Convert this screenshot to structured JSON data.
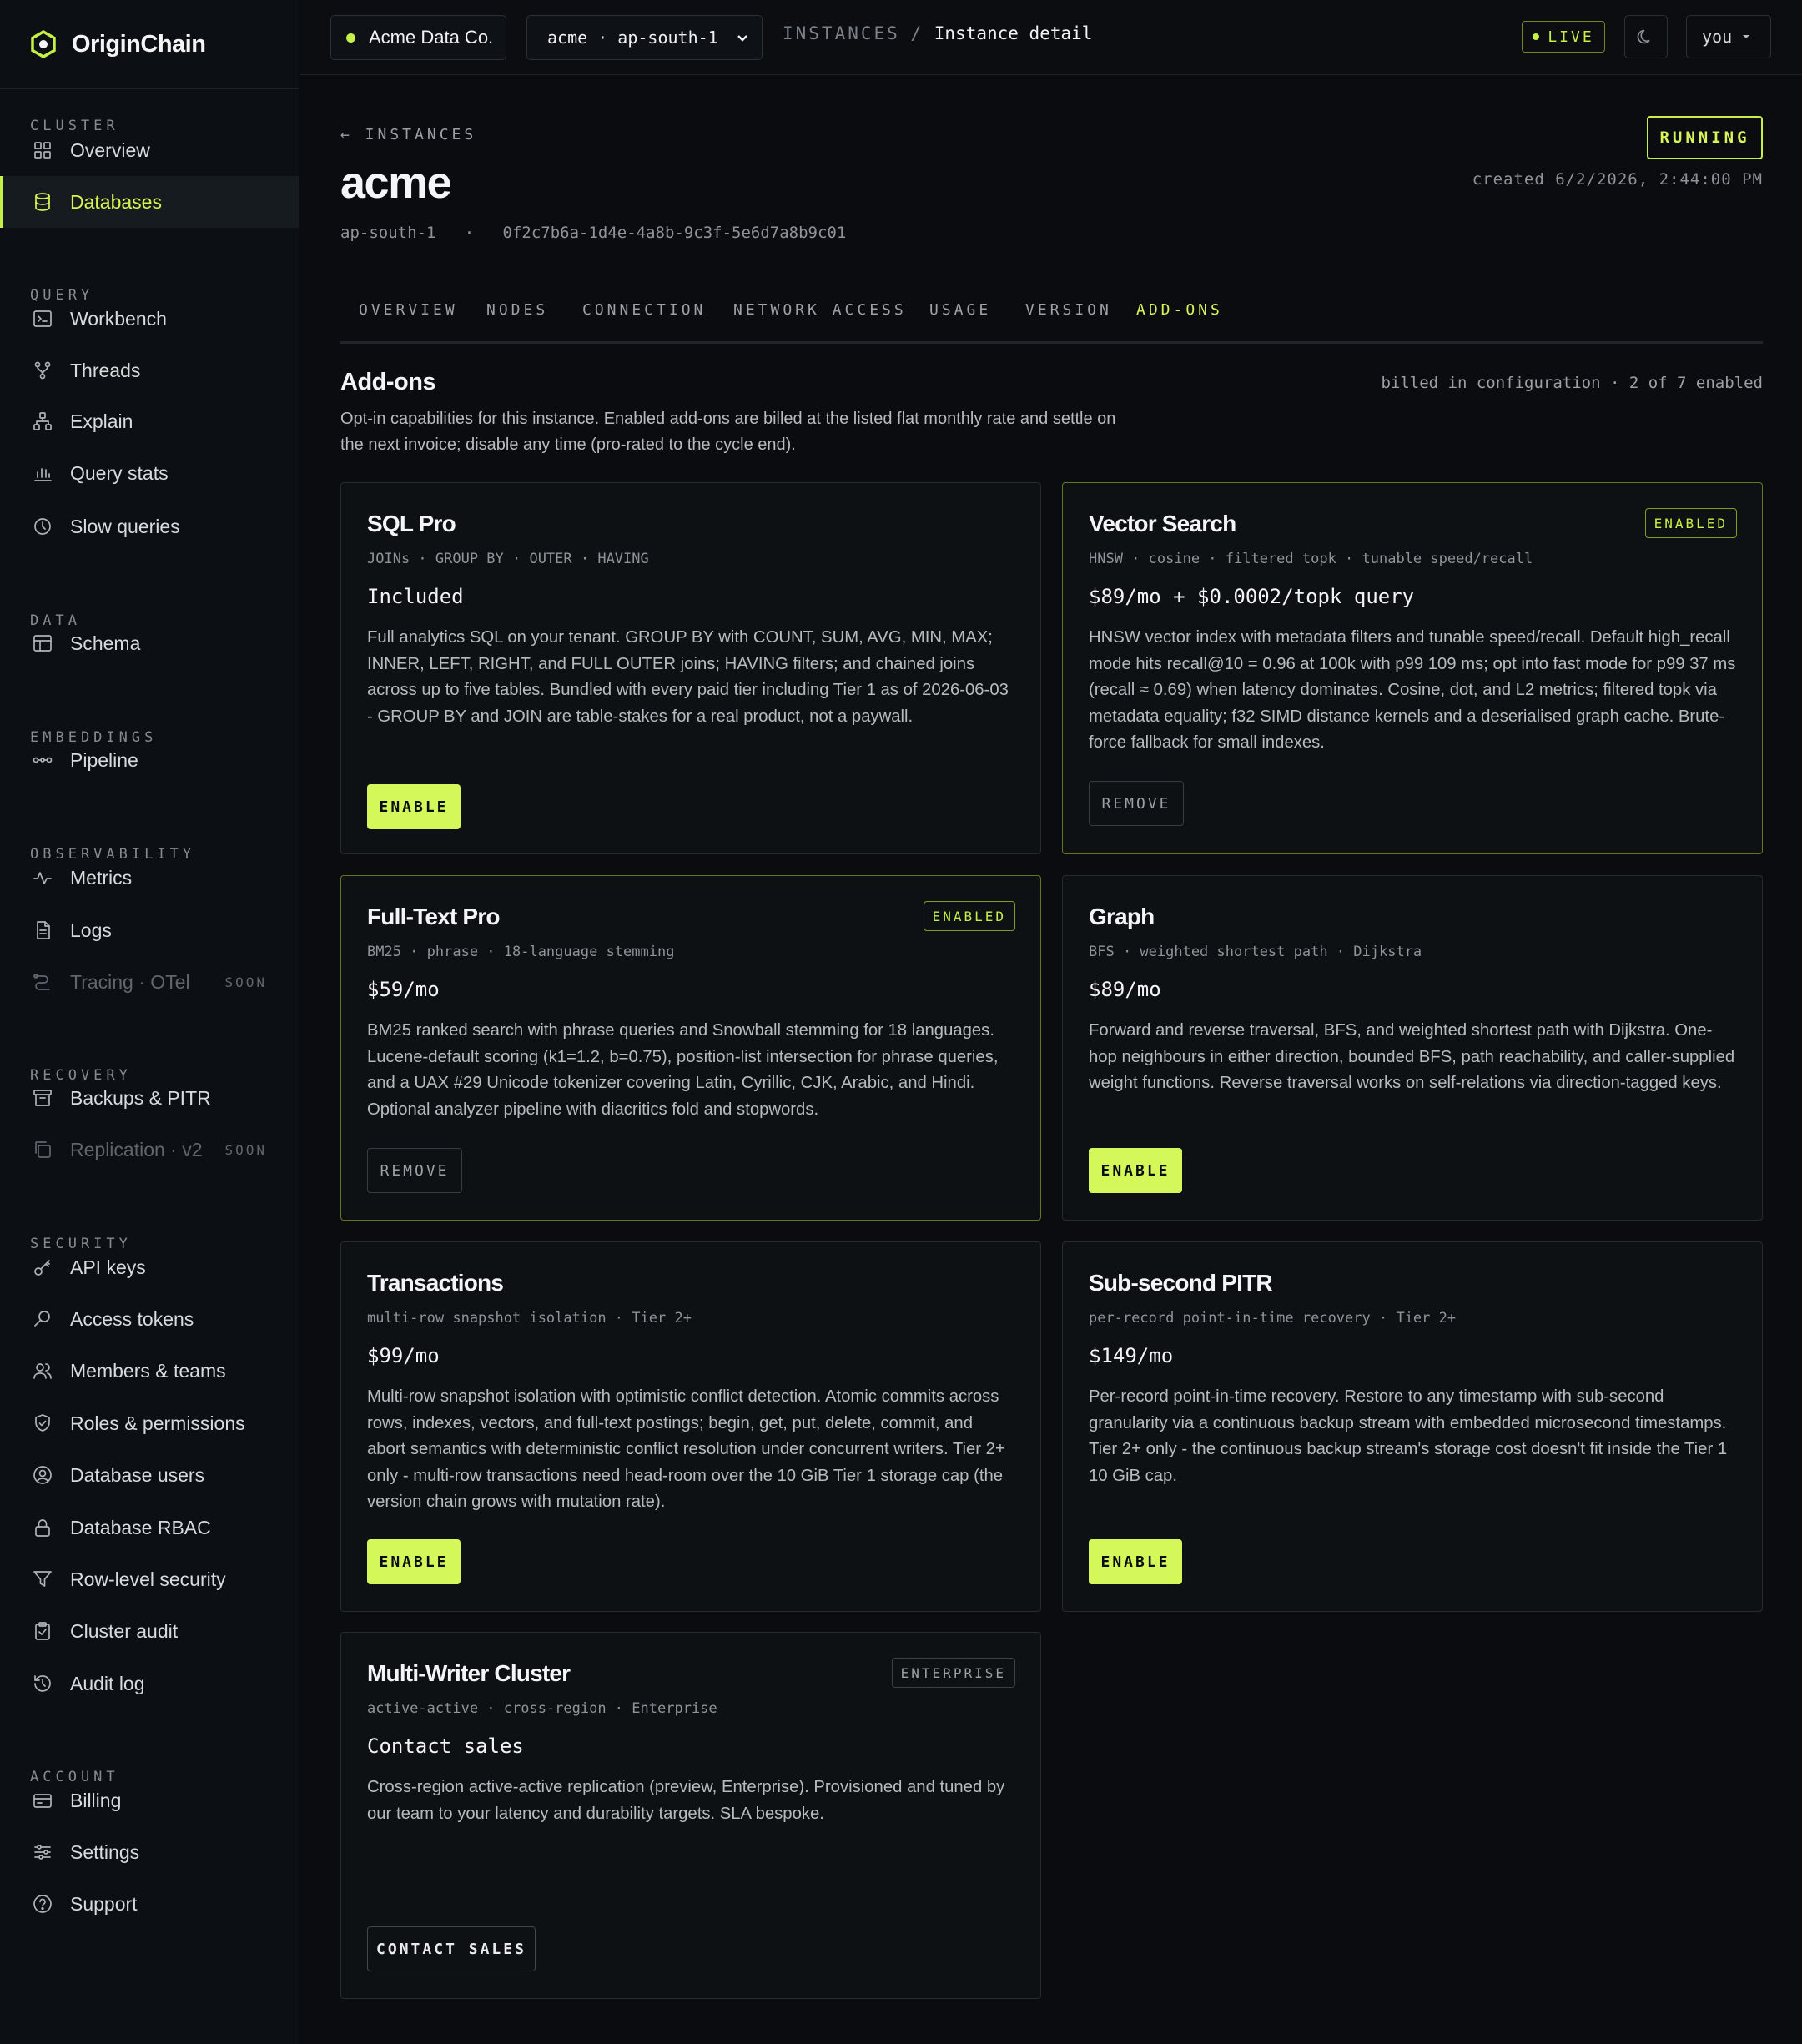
{
  "app": {
    "name": "OriginChain",
    "accent": "#c6f045"
  },
  "sidebar": {
    "sections": [
      {
        "heading": "CLUSTER",
        "items": [
          {
            "label": "Overview",
            "icon": "grid-icon"
          },
          {
            "label": "Databases",
            "icon": "database-icon",
            "active": true
          }
        ]
      },
      {
        "heading": "QUERY",
        "items": [
          {
            "label": "Workbench",
            "icon": "terminal-icon"
          },
          {
            "label": "Threads",
            "icon": "branch-icon"
          },
          {
            "label": "Explain",
            "icon": "hierarchy-icon"
          },
          {
            "label": "Query stats",
            "icon": "bar-chart-icon"
          },
          {
            "label": "Slow queries",
            "icon": "clock-icon"
          }
        ]
      },
      {
        "heading": "DATA",
        "items": [
          {
            "label": "Schema",
            "icon": "table-icon"
          }
        ]
      },
      {
        "heading": "EMBEDDINGS",
        "items": [
          {
            "label": "Pipeline",
            "icon": "pipeline-icon"
          }
        ]
      },
      {
        "heading": "OBSERVABILITY",
        "items": [
          {
            "label": "Metrics",
            "icon": "pulse-icon"
          },
          {
            "label": "Logs",
            "icon": "file-icon"
          },
          {
            "label": "Tracing · OTel",
            "icon": "trace-icon",
            "disabled": true,
            "tag": "SOON"
          }
        ]
      },
      {
        "heading": "RECOVERY",
        "items": [
          {
            "label": "Backups & PITR",
            "icon": "archive-icon"
          },
          {
            "label": "Replication · v2",
            "icon": "copy-icon",
            "disabled": true,
            "tag": "SOON"
          }
        ]
      },
      {
        "heading": "SECURITY",
        "items": [
          {
            "label": "API keys",
            "icon": "key-icon"
          },
          {
            "label": "Access tokens",
            "icon": "search-key-icon"
          },
          {
            "label": "Members & teams",
            "icon": "users-icon"
          },
          {
            "label": "Roles & permissions",
            "icon": "shield-icon"
          },
          {
            "label": "Database users",
            "icon": "user-circle-icon"
          },
          {
            "label": "Database RBAC",
            "icon": "lock-icon"
          },
          {
            "label": "Row-level security",
            "icon": "filter-icon"
          },
          {
            "label": "Cluster audit",
            "icon": "clipboard-icon"
          },
          {
            "label": "Audit log",
            "icon": "history-icon"
          }
        ]
      },
      {
        "heading": "ACCOUNT",
        "items": [
          {
            "label": "Billing",
            "icon": "credit-card-icon"
          },
          {
            "label": "Settings",
            "icon": "sliders-icon"
          },
          {
            "label": "Support",
            "icon": "help-icon"
          }
        ]
      }
    ]
  },
  "topbar": {
    "org": "Acme Data Co.",
    "region_select": "acme · ap-south-1",
    "breadcrumb_parent": "INSTANCES",
    "breadcrumb_sep": "/",
    "breadcrumb_current": "Instance detail",
    "live_label": "LIVE",
    "user_label": "you"
  },
  "instance": {
    "back_label": "← INSTANCES",
    "name": "acme",
    "region": "ap-south-1",
    "id": "0f2c7b6a-1d4e-4a8b-9c3f-5e6d7a8b9c01",
    "status": "RUNNING",
    "created": "created 6/2/2026, 2:44:00 PM"
  },
  "tabs": [
    "OVERVIEW",
    "NODES",
    "CONNECTION",
    "NETWORK ACCESS",
    "USAGE",
    "VERSION",
    "ADD-ONS"
  ],
  "active_tab": "ADD-ONS",
  "addons": {
    "title": "Add-ons",
    "meta": "billed in configuration · 2 of 7 enabled",
    "description": "Opt-in capabilities for this instance. Enabled add-ons are billed at the listed flat monthly rate and settle on the next invoice; disable any time (pro-rated to the cycle end).",
    "cards": [
      {
        "title": "SQL Pro",
        "tags": "JOINs · GROUP BY · OUTER · HAVING",
        "price": "Included",
        "desc": "Full analytics SQL on your tenant. GROUP BY with COUNT, SUM, AVG, MIN, MAX; INNER, LEFT, RIGHT, and FULL OUTER joins; HAVING filters; and chained joins across up to five tables. Bundled with every paid tier including Tier 1 as of 2026-06-03 - GROUP BY and JOIN are table-stakes for a real product, not a paywall.",
        "badge": "",
        "button": "ENABLE"
      },
      {
        "title": "Vector Search",
        "tags": "HNSW · cosine · filtered topk · tunable speed/recall",
        "price": "$89/mo + $0.0002/topk query",
        "desc": "HNSW vector index with metadata filters and tunable speed/recall. Default high_recall mode hits recall@10 = 0.96 at 100k with p99 109 ms; opt into fast mode for p99 37 ms (recall ≈ 0.69) when latency dominates. Cosine, dot, and L2 metrics; filtered topk via metadata equality; f32 SIMD distance kernels and a deserialised graph cache. Brute-force fallback for small indexes.",
        "badge": "ENABLED",
        "button": "REMOVE"
      },
      {
        "title": "Full-Text Pro",
        "tags": "BM25 · phrase · 18-language stemming",
        "price": "$59/mo",
        "desc": "BM25 ranked search with phrase queries and Snowball stemming for 18 languages. Lucene-default scoring (k1=1.2, b=0.75), position-list intersection for phrase queries, and a UAX #29 Unicode tokenizer covering Latin, Cyrillic, CJK, Arabic, and Hindi. Optional analyzer pipeline with diacritics fold and stopwords.",
        "badge": "ENABLED",
        "button": "REMOVE"
      },
      {
        "title": "Graph",
        "tags": "BFS · weighted shortest path · Dijkstra",
        "price": "$89/mo",
        "desc": "Forward and reverse traversal, BFS, and weighted shortest path with Dijkstra. One-hop neighbours in either direction, bounded BFS, path reachability, and caller-supplied weight functions. Reverse traversal works on self-relations via direction-tagged keys.",
        "badge": "",
        "button": "ENABLE"
      },
      {
        "title": "Transactions",
        "tags": "multi-row snapshot isolation · Tier 2+",
        "price": "$99/mo",
        "desc": "Multi-row snapshot isolation with optimistic conflict detection. Atomic commits across rows, indexes, vectors, and full-text postings; begin, get, put, delete, commit, and abort semantics with deterministic conflict resolution under concurrent writers. Tier 2+ only - multi-row transactions need head-room over the 10 GiB Tier 1 storage cap (the version chain grows with mutation rate).",
        "badge": "",
        "button": "ENABLE"
      },
      {
        "title": "Sub-second PITR",
        "tags": "per-record point-in-time recovery · Tier 2+",
        "price": "$149/mo",
        "desc": "Per-record point-in-time recovery. Restore to any timestamp with sub-second granularity via a continuous backup stream with embedded microsecond timestamps. Tier 2+ only - the continuous backup stream's storage cost doesn't fit inside the Tier 1 10 GiB cap.",
        "badge": "",
        "button": "ENABLE"
      },
      {
        "title": "Multi-Writer Cluster",
        "tags": "active-active · cross-region · Enterprise",
        "price": "Contact sales",
        "desc": "Cross-region active-active replication (preview, Enterprise). Provisioned and tuned by our team to your latency and durability targets. SLA bespoke.",
        "badge": "ENTERPRISE",
        "button": "CONTACT SALES"
      }
    ]
  }
}
